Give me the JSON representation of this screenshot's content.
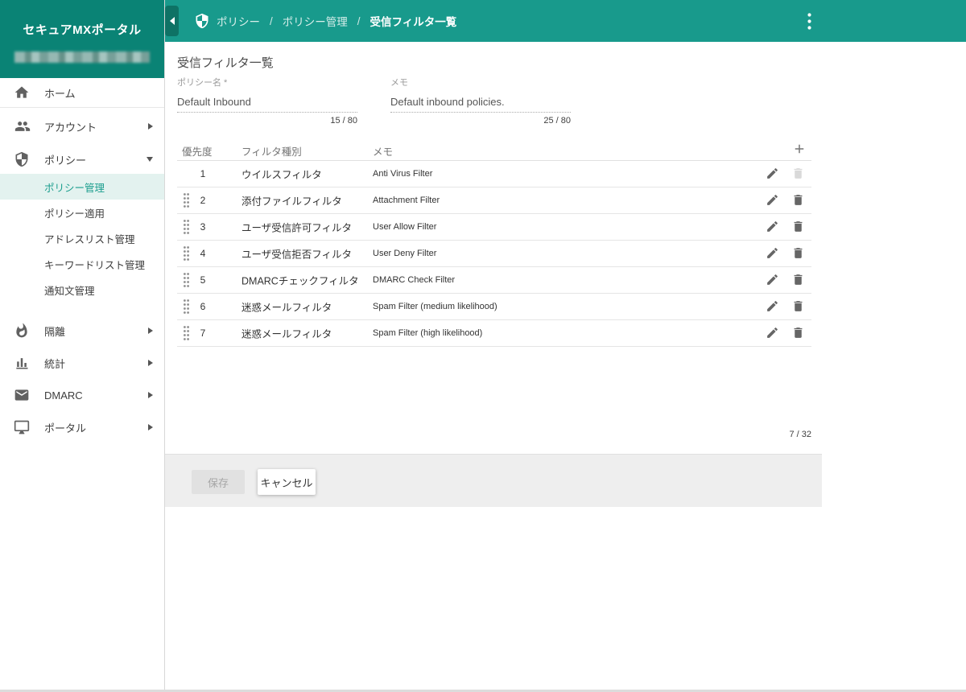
{
  "app": {
    "title": "セキュアMXポータル"
  },
  "colors": {
    "teal_header": "#189a8c",
    "teal_logo": "#0a8375",
    "teal_tab": "#0e7265",
    "accent": "#1b9e8e",
    "selected_bg": "#e3f2ef"
  },
  "header": {
    "separator": "/",
    "breadcrumbs": [
      {
        "label": "ポリシー"
      },
      {
        "label": "ポリシー管理"
      },
      {
        "label": "受信フィルタ一覧"
      }
    ]
  },
  "sidebar": {
    "items": [
      {
        "label": "ホーム",
        "icon": "home"
      },
      {
        "label": "アカウント",
        "icon": "people",
        "expand": "right"
      },
      {
        "label": "ポリシー",
        "icon": "shield",
        "expand": "down",
        "children": [
          {
            "label": "ポリシー管理",
            "selected": true
          },
          {
            "label": "ポリシー適用"
          },
          {
            "label": "アドレスリスト管理"
          },
          {
            "label": "キーワードリスト管理"
          },
          {
            "label": "通知文管理"
          }
        ]
      },
      {
        "label": "隔離",
        "icon": "flame",
        "expand": "right"
      },
      {
        "label": "統計",
        "icon": "bar-chart",
        "expand": "right"
      },
      {
        "label": "DMARC",
        "icon": "mail",
        "expand": "right"
      },
      {
        "label": "ポータル",
        "icon": "monitor",
        "expand": "right"
      }
    ]
  },
  "main": {
    "title": "受信フィルタ一覧",
    "fields": [
      {
        "label": "ポリシー名 *",
        "value": "Default Inbound",
        "counter": "15 / 80"
      },
      {
        "label": "メモ",
        "value": "Default inbound policies.",
        "counter": "25 / 80"
      }
    ],
    "table": {
      "columns": [
        "優先度",
        "フィルタ種別",
        "メモ"
      ],
      "rows": [
        {
          "priority": "1",
          "type": "ウイルスフィルタ",
          "memo": "Anti Virus Filter",
          "draggable": false,
          "delete_enabled": false
        },
        {
          "priority": "2",
          "type": "添付ファイルフィルタ",
          "memo": "Attachment Filter",
          "draggable": true,
          "delete_enabled": true
        },
        {
          "priority": "3",
          "type": "ユーザ受信許可フィルタ",
          "memo": "User Allow Filter",
          "draggable": true,
          "delete_enabled": true
        },
        {
          "priority": "4",
          "type": "ユーザ受信拒否フィルタ",
          "memo": "User Deny Filter",
          "draggable": true,
          "delete_enabled": true
        },
        {
          "priority": "5",
          "type": "DMARCチェックフィルタ",
          "memo": "DMARC Check Filter",
          "draggable": true,
          "delete_enabled": true
        },
        {
          "priority": "6",
          "type": "迷惑メールフィルタ",
          "memo": "Spam Filter (medium likelihood)",
          "draggable": true,
          "delete_enabled": true
        },
        {
          "priority": "7",
          "type": "迷惑メールフィルタ",
          "memo": "Spam Filter (high likelihood)",
          "draggable": true,
          "delete_enabled": true
        }
      ],
      "count": "7 / 32"
    },
    "footer": {
      "save_label": "保存",
      "cancel_label": "キャンセル"
    }
  }
}
